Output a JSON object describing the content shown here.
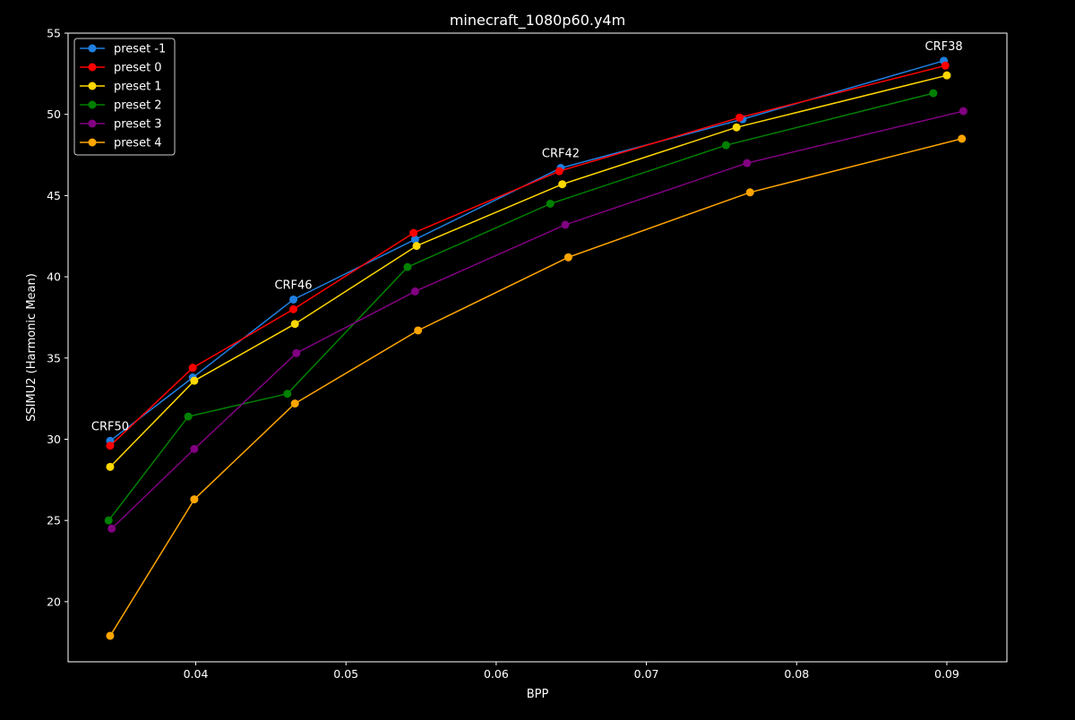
{
  "chart_data": {
    "type": "line",
    "title": "minecraft_1080p60.y4m",
    "xlabel": "BPP",
    "ylabel": "SSIMU2 (Harmonic Mean)",
    "xlim": [
      0.0315,
      0.094
    ],
    "ylim": [
      16.3,
      55
    ],
    "xticks": [
      "0.04",
      "0.05",
      "0.06",
      "0.07",
      "0.08",
      "0.09"
    ],
    "yticks": [
      "20",
      "25",
      "30",
      "35",
      "40",
      "45",
      "50",
      "55"
    ],
    "grid": false,
    "legend_position": "top-left",
    "series": [
      {
        "name": "preset -1",
        "color": "#1f7fe0",
        "x": [
          0.0343,
          0.0398,
          0.0465,
          0.0546,
          0.0643,
          0.0764,
          0.0898
        ],
        "y": [
          29.9,
          33.8,
          38.6,
          42.3,
          46.7,
          49.7,
          53.3
        ]
      },
      {
        "name": "preset 0",
        "color": "#ff0000",
        "x": [
          0.0343,
          0.0398,
          0.0465,
          0.0545,
          0.0642,
          0.0762,
          0.0899
        ],
        "y": [
          29.6,
          34.4,
          38.0,
          42.7,
          46.5,
          49.8,
          53.0
        ]
      },
      {
        "name": "preset 1",
        "color": "#ffd700",
        "x": [
          0.0343,
          0.0399,
          0.0466,
          0.0547,
          0.0644,
          0.076,
          0.09
        ],
        "y": [
          28.3,
          33.6,
          37.1,
          41.9,
          45.7,
          49.2,
          52.4
        ]
      },
      {
        "name": "preset 2",
        "color": "#008000",
        "x": [
          0.0342,
          0.0395,
          0.0461,
          0.0541,
          0.0636,
          0.0753,
          0.0891
        ],
        "y": [
          25.0,
          31.4,
          32.8,
          40.6,
          44.5,
          48.1,
          51.3
        ]
      },
      {
        "name": "preset 3",
        "color": "#800080",
        "x": [
          0.0344,
          0.0399,
          0.0467,
          0.0546,
          0.0646,
          0.0767,
          0.0911
        ],
        "y": [
          24.5,
          29.4,
          35.3,
          39.1,
          43.2,
          47.0,
          50.2
        ]
      },
      {
        "name": "preset 4",
        "color": "#ffa500",
        "x": [
          0.0343,
          0.0399,
          0.0466,
          0.0548,
          0.0648,
          0.0769,
          0.091
        ],
        "y": [
          17.9,
          26.3,
          32.2,
          36.7,
          41.2,
          45.2,
          48.5
        ]
      }
    ],
    "annotations": [
      {
        "text": "CRF50",
        "x": 0.0343,
        "y": 29.9
      },
      {
        "text": "CRF46",
        "x": 0.0465,
        "y": 38.6
      },
      {
        "text": "CRF42",
        "x": 0.0643,
        "y": 46.7
      },
      {
        "text": "CRF38",
        "x": 0.0898,
        "y": 53.3
      }
    ]
  }
}
